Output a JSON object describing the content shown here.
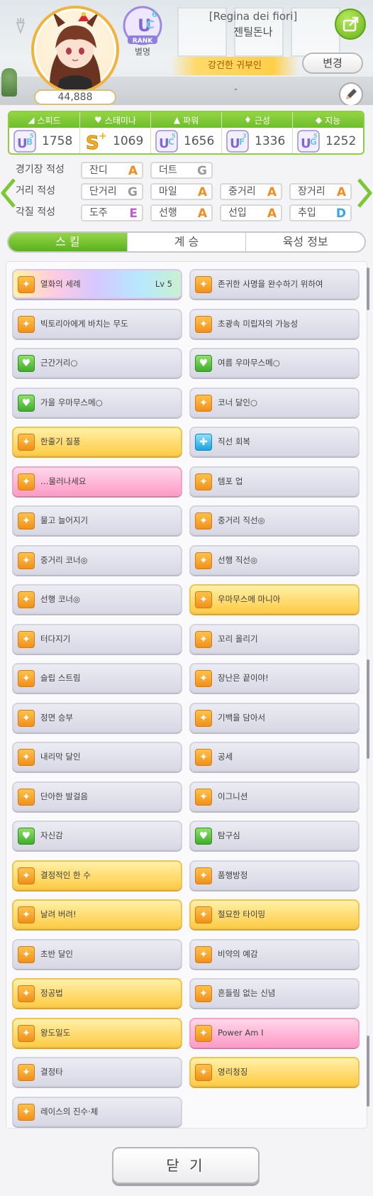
{
  "profile": {
    "fans": "44,888",
    "rank_grade": "UC",
    "rank_sub": "6",
    "rank_word": "RANK",
    "rank_label": "별명",
    "title_en": "[Regina dei fiori]",
    "name": "젠틸돈나",
    "epithet": "강건한 귀부인",
    "change_label": "변경",
    "placeholder_dash": "-"
  },
  "stats": [
    {
      "name": "스피드",
      "icon": "shoe-icon",
      "grade": "UB",
      "sub": "5",
      "value": "1758"
    },
    {
      "name": "스태미나",
      "icon": "heart-icon",
      "grade": "S+",
      "sub": "",
      "value": "1069"
    },
    {
      "name": "파워",
      "icon": "muscle-icon",
      "grade": "UC",
      "sub": "5",
      "value": "1656"
    },
    {
      "name": "근성",
      "icon": "flame-icon",
      "grade": "UF",
      "sub": "3",
      "value": "1336"
    },
    {
      "name": "지능",
      "icon": "graduation-cap-icon",
      "grade": "UG",
      "sub": "5",
      "value": "1252"
    }
  ],
  "aptitude": {
    "track": {
      "label": "경기장 적성",
      "items": [
        {
          "name": "잔디",
          "grade": "A"
        },
        {
          "name": "더트",
          "grade": "G"
        }
      ]
    },
    "distance": {
      "label": "거리 적성",
      "items": [
        {
          "name": "단거리",
          "grade": "G"
        },
        {
          "name": "마일",
          "grade": "A"
        },
        {
          "name": "중거리",
          "grade": "A"
        },
        {
          "name": "장거리",
          "grade": "A"
        }
      ]
    },
    "style": {
      "label": "각질 적성",
      "items": [
        {
          "name": "도주",
          "grade": "E"
        },
        {
          "name": "선행",
          "grade": "A"
        },
        {
          "name": "선입",
          "grade": "A"
        },
        {
          "name": "추입",
          "grade": "D"
        }
      ]
    }
  },
  "tabs": [
    "스 킬",
    "계 승",
    "육성 정보"
  ],
  "skills": [
    {
      "name": "열화의 세례",
      "lv": "Lv 5",
      "style": "rainbow",
      "icon": "speed"
    },
    {
      "name": "존귀한 사명을 완수하기 위하여",
      "lv": "",
      "style": "plain",
      "icon": "speed"
    },
    {
      "name": "빅토리아에게 바치는 무도",
      "lv": "",
      "style": "plain",
      "icon": "speed"
    },
    {
      "name": "초광속 미립자의 가능성",
      "lv": "",
      "style": "plain",
      "icon": "speed"
    },
    {
      "name": "근간거리○",
      "lv": "",
      "style": "plain",
      "icon": "heal"
    },
    {
      "name": "여름 우마무스메○",
      "lv": "",
      "style": "plain",
      "icon": "heal"
    },
    {
      "name": "가을 우마무스메○",
      "lv": "",
      "style": "plain",
      "icon": "heal"
    },
    {
      "name": "코너 달인○",
      "lv": "",
      "style": "plain",
      "icon": "speed"
    },
    {
      "name": "한줄기 질풍",
      "lv": "",
      "style": "gold",
      "icon": "speed"
    },
    {
      "name": "직선 회복",
      "lv": "",
      "style": "plain",
      "icon": "blue"
    },
    {
      "name": "…물러나세요",
      "lv": "",
      "style": "pink",
      "icon": "speed"
    },
    {
      "name": "템포 업",
      "lv": "",
      "style": "plain",
      "icon": "speed"
    },
    {
      "name": "물고 늘어지기",
      "lv": "",
      "style": "plain",
      "icon": "speed"
    },
    {
      "name": "중거리 직선◎",
      "lv": "",
      "style": "plain",
      "icon": "speed"
    },
    {
      "name": "중거리 코너◎",
      "lv": "",
      "style": "plain",
      "icon": "speed"
    },
    {
      "name": "선행 직선◎",
      "lv": "",
      "style": "plain",
      "icon": "speed"
    },
    {
      "name": "선행 코너◎",
      "lv": "",
      "style": "plain",
      "icon": "speed"
    },
    {
      "name": "우마무스메 마니아",
      "lv": "",
      "style": "gold",
      "icon": "speed"
    },
    {
      "name": "터다지기",
      "lv": "",
      "style": "plain",
      "icon": "speed"
    },
    {
      "name": "꼬리 올리기",
      "lv": "",
      "style": "plain",
      "icon": "speed"
    },
    {
      "name": "슬립 스트림",
      "lv": "",
      "style": "plain",
      "icon": "speed"
    },
    {
      "name": "장난은 끝이야!",
      "lv": "",
      "style": "plain",
      "icon": "speed"
    },
    {
      "name": "정면 승부",
      "lv": "",
      "style": "plain",
      "icon": "speed"
    },
    {
      "name": "기백을 담아서",
      "lv": "",
      "style": "plain",
      "icon": "speed"
    },
    {
      "name": "내리막 달인",
      "lv": "",
      "style": "plain",
      "icon": "speed"
    },
    {
      "name": "공세",
      "lv": "",
      "style": "plain",
      "icon": "speed"
    },
    {
      "name": "단아한 발걸음",
      "lv": "",
      "style": "plain",
      "icon": "speed"
    },
    {
      "name": "이그니션",
      "lv": "",
      "style": "plain",
      "icon": "speed"
    },
    {
      "name": "자신감",
      "lv": "",
      "style": "plain",
      "icon": "heal"
    },
    {
      "name": "탐구심",
      "lv": "",
      "style": "plain",
      "icon": "heal"
    },
    {
      "name": "결정적인 한 수",
      "lv": "",
      "style": "gold",
      "icon": "speed"
    },
    {
      "name": "품행방정",
      "lv": "",
      "style": "plain",
      "icon": "speed"
    },
    {
      "name": "날려 버려!",
      "lv": "",
      "style": "gold",
      "icon": "speed"
    },
    {
      "name": "절묘한 타이밍",
      "lv": "",
      "style": "gold",
      "icon": "speed"
    },
    {
      "name": "초반 달인",
      "lv": "",
      "style": "plain",
      "icon": "speed"
    },
    {
      "name": "비약의 예감",
      "lv": "",
      "style": "plain",
      "icon": "speed"
    },
    {
      "name": "정공법",
      "lv": "",
      "style": "gold",
      "icon": "speed"
    },
    {
      "name": "흔들림 없는 신념",
      "lv": "",
      "style": "plain",
      "icon": "speed"
    },
    {
      "name": "왕도일도",
      "lv": "",
      "style": "gold",
      "icon": "speed"
    },
    {
      "name": "Power Am I",
      "lv": "",
      "style": "pink",
      "icon": "speed"
    },
    {
      "name": "결정타",
      "lv": "",
      "style": "plain",
      "icon": "speed"
    },
    {
      "name": "영리청징",
      "lv": "",
      "style": "gold",
      "icon": "speed"
    },
    {
      "name": "레이스의 진수·체",
      "lv": "",
      "style": "plain",
      "icon": "speed"
    }
  ],
  "close_label": "닫 기",
  "colors": {
    "accent_green": "#7cc733",
    "gold": "#ffcc46",
    "pink": "#ff9cc8"
  }
}
